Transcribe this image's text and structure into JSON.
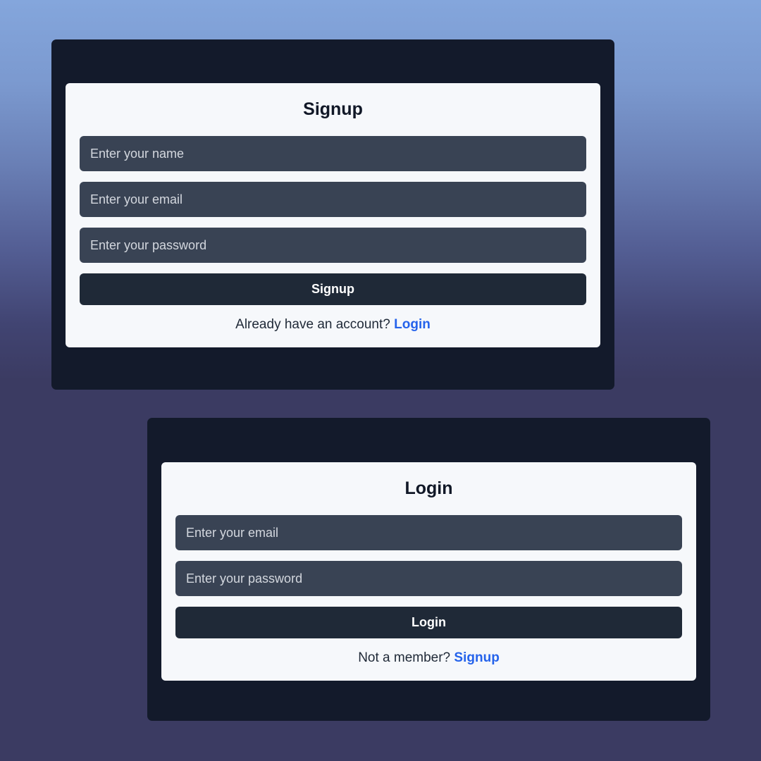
{
  "signup": {
    "title": "Signup",
    "name_placeholder": "Enter your name",
    "email_placeholder": "Enter your email",
    "password_placeholder": "Enter your password",
    "button_label": "Signup",
    "switch_prompt": "Already have an account?",
    "switch_link": "Login"
  },
  "login": {
    "title": "Login",
    "email_placeholder": "Enter your email",
    "password_placeholder": "Enter your password",
    "button_label": "Login",
    "switch_prompt": "Not a member?",
    "switch_link": "Signup"
  },
  "colors": {
    "panel": "#131a2b",
    "card": "#f6f8fb",
    "input": "#394354",
    "button": "#1f2937",
    "link": "#2563eb"
  }
}
